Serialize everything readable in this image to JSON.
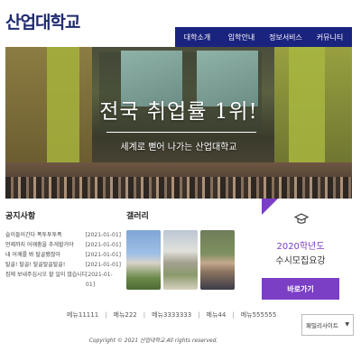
{
  "header": {
    "logo": "산업대학교",
    "nav": [
      "대학소개",
      "입학안내",
      "정보서비스",
      "커뮤니티"
    ]
  },
  "hero": {
    "title": "전국 취업률 1위!",
    "subtitle": "세계로 뻗어 나가는 산업대학교"
  },
  "notice": {
    "title": "공지사항",
    "items": [
      {
        "text": "슬이들이간다 폭투투투폭",
        "date": "2021-01-01"
      },
      {
        "text": "언제까지 어깨춤을 추게할거야",
        "date": "2021-01-01"
      },
      {
        "text": "내 어깨를 봐 탈골됐잖아",
        "date": "2021-01-01"
      },
      {
        "text": "탈골! 탈골! 탈골탈골탈골!",
        "date": "2021-01-01"
      },
      {
        "text": "집에 보내주십시오 할 일이 많습니다",
        "date": "2021-01-01"
      }
    ]
  },
  "gallery": {
    "title": "갤러리"
  },
  "admission": {
    "icon": "graduation-cap-icon",
    "year": "2020학년도",
    "title": "수시모집요강",
    "button": "바로가기",
    "accent": "#7b3fc6"
  },
  "footer": {
    "menu": [
      "메뉴11111",
      "메뉴222",
      "메뉴3333333",
      "메뉴44",
      "메뉴555555"
    ],
    "family_site": "패밀리사이트",
    "copyright": "Copyright © 2021 산업대학교 All rights reserved."
  },
  "colors": {
    "nav_bg": "#1a237e",
    "logo": "#1f2a6e"
  }
}
